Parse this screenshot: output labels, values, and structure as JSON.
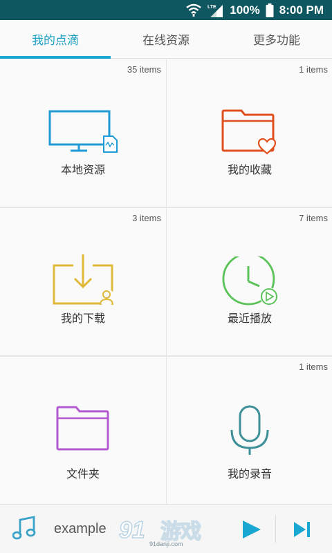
{
  "status_bar": {
    "battery": "100%",
    "time": "8:00 PM",
    "network": "LTE",
    "icons": [
      "wifi-icon",
      "lte-signal-icon",
      "battery-icon"
    ]
  },
  "tabs": [
    {
      "label": "我的点滴",
      "active": true
    },
    {
      "label": "在线资源",
      "active": false
    },
    {
      "label": "更多功能",
      "active": false
    }
  ],
  "tiles": [
    {
      "label": "本地资源",
      "count": "35 items",
      "icon": "monitor-icon",
      "color": "#1e9ad6"
    },
    {
      "label": "我的收藏",
      "count": "1 items",
      "icon": "favorite-folder-icon",
      "color": "#e0501f"
    },
    {
      "label": "我的下载",
      "count": "3 items",
      "icon": "download-icon",
      "color": "#e0b83a"
    },
    {
      "label": "最近播放",
      "count": "7 items",
      "icon": "recent-play-icon",
      "color": "#5cc25a"
    },
    {
      "label": "文件夹",
      "count": "",
      "icon": "folder-icon",
      "color": "#b25ad0"
    },
    {
      "label": "我的录音",
      "count": "1 items",
      "icon": "microphone-icon",
      "color": "#3d8f98"
    }
  ],
  "player": {
    "title": "example",
    "icons": [
      "music-note-icon",
      "play-icon",
      "next-icon"
    ]
  },
  "watermark": {
    "text": "游戏",
    "number": "91",
    "url": "91danji.com"
  }
}
